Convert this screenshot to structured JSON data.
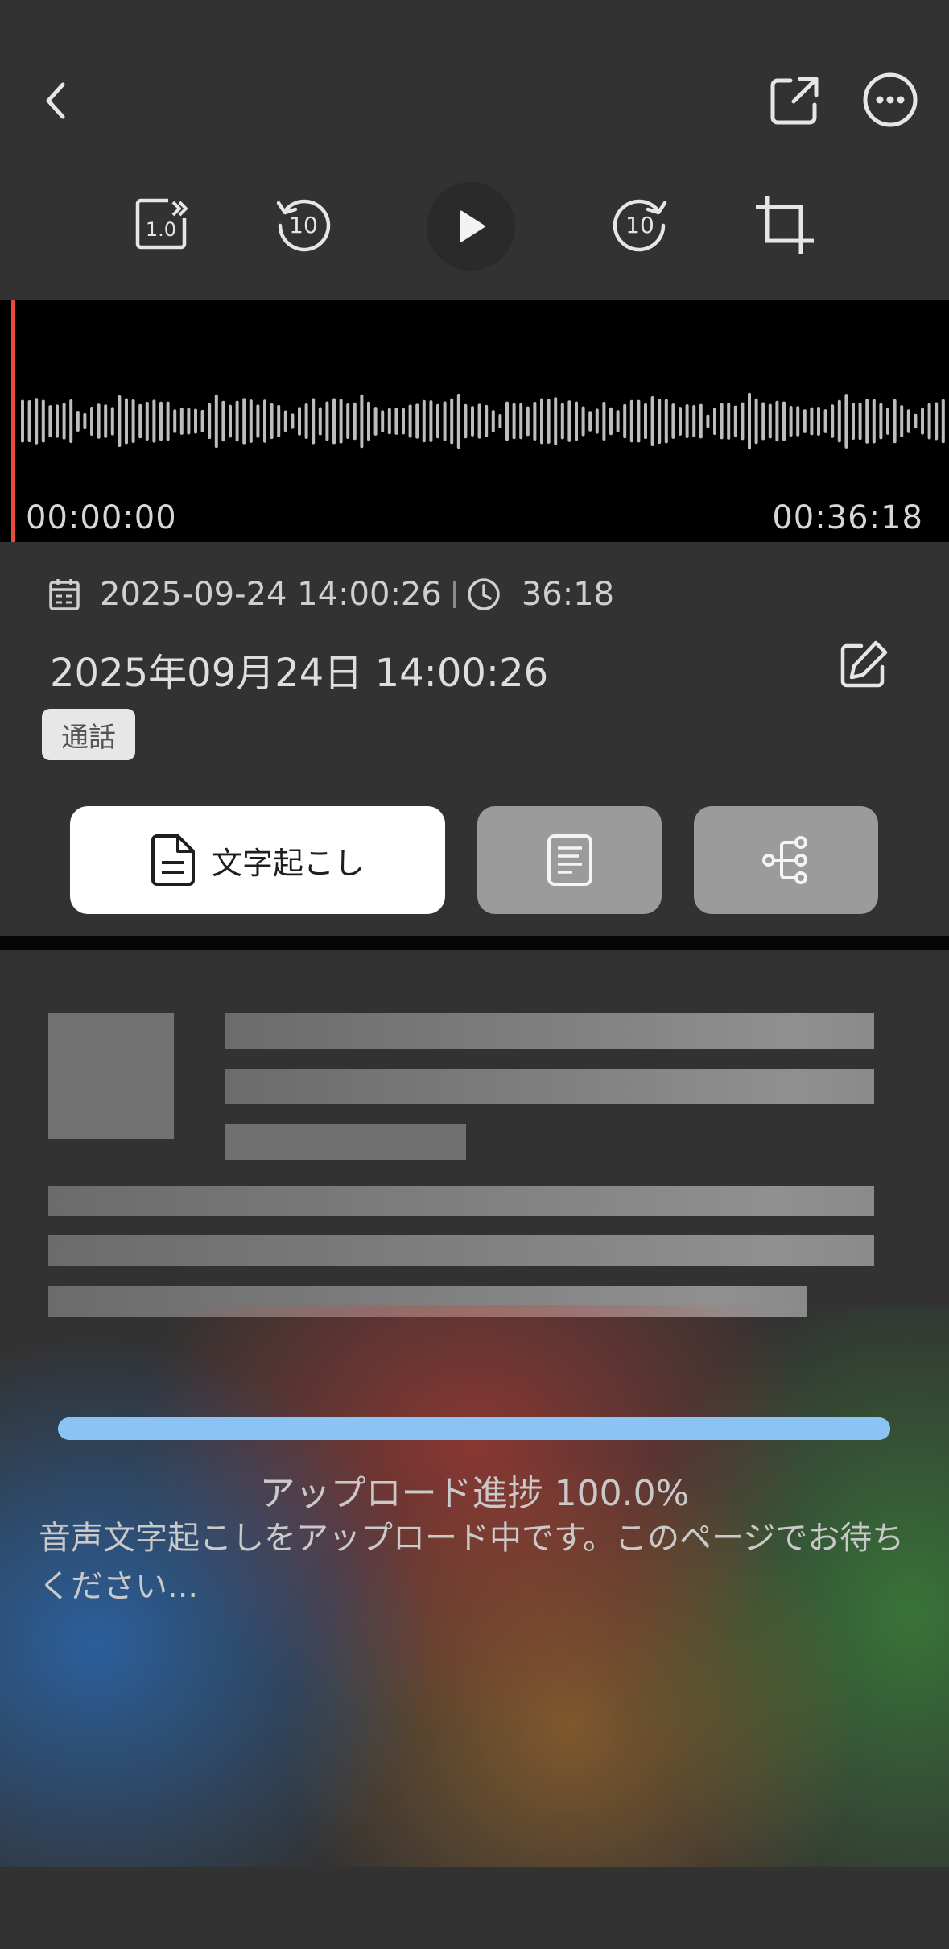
{
  "toolbar": {
    "speed_label": "1.0",
    "rewind_label": "10",
    "forward_label": "10"
  },
  "player": {
    "current_time": "00:00:00",
    "total_time": "00:36:18",
    "progress": 0.0
  },
  "recording": {
    "datetime": "2025-09-24 14:00:26",
    "duration": "36:18",
    "title": "2025年09月24日 14:00:26",
    "tag": "通話"
  },
  "tabs": {
    "transcript_label": "文字起こし"
  },
  "upload": {
    "percent": 100.0,
    "label": "アップロード進捗 100.0%",
    "message": "音声文字起こしをアップロード中です。このページでお待ちください..."
  },
  "colors": {
    "background": "#323232",
    "playhead": "#e84a3c",
    "progress": "#8bc3f4",
    "tab_active": "#ffffff",
    "tab_inactive": "#9b9b9b"
  },
  "icons": [
    "back-icon",
    "share-icon",
    "more-icon",
    "speed-icon",
    "rewind-10-icon",
    "play-icon",
    "forward-10-icon",
    "crop-icon",
    "calendar-icon",
    "clock-icon",
    "edit-icon",
    "document-icon",
    "summary-icon",
    "mindmap-icon"
  ]
}
